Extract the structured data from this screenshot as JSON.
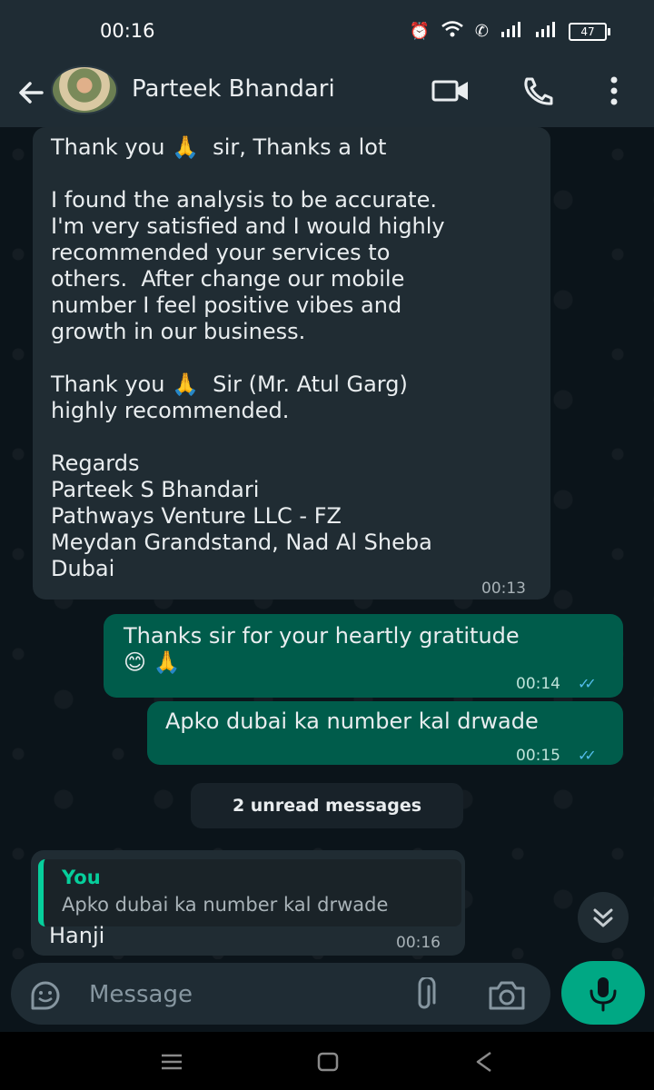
{
  "status_bar": {
    "time": "00:16",
    "battery": "47"
  },
  "header": {
    "contact_name": "Parteek Bhandari"
  },
  "messages": [
    {
      "direction": "incoming",
      "text": "Thank you 🙏  sir, Thanks a lot\n\nI found the analysis to be accurate.\nI'm very satisfied and I would highly\nrecommended your services to\nothers.  After change our mobile\nnumber I feel positive vibes and\ngrowth in our business.\n\nThank you 🙏  Sir (Mr. Atul Garg)\nhighly recommended.\n\nRegards\nParteek S Bhandari\nPathways Venture LLC - FZ\nMeydan Grandstand, Nad Al Sheba\nDubai",
      "time": "00:13"
    },
    {
      "direction": "outgoing",
      "text": "Thanks sir for your heartly gratitude\n😊 🙏",
      "time": "00:14"
    },
    {
      "direction": "outgoing",
      "text": "Apko dubai ka number kal drwade",
      "time": "00:15"
    }
  ],
  "unread_divider": "2 unread messages",
  "reply_message": {
    "quote_author": "You",
    "quote_text": "Apko dubai ka number kal drwade",
    "text": "Hanji",
    "time": "00:16"
  },
  "composer": {
    "placeholder": "Message"
  },
  "colors": {
    "incoming_bubble": "#202c33",
    "outgoing_bubble": "#005c4b",
    "accent": "#00a884",
    "read_ticks": "#53bdeb"
  },
  "icons": [
    "back-arrow-icon",
    "video-call-icon",
    "phone-icon",
    "more-vert-icon",
    "sticker-icon",
    "attachment-icon",
    "camera-icon",
    "mic-icon",
    "chevron-double-down-icon"
  ]
}
